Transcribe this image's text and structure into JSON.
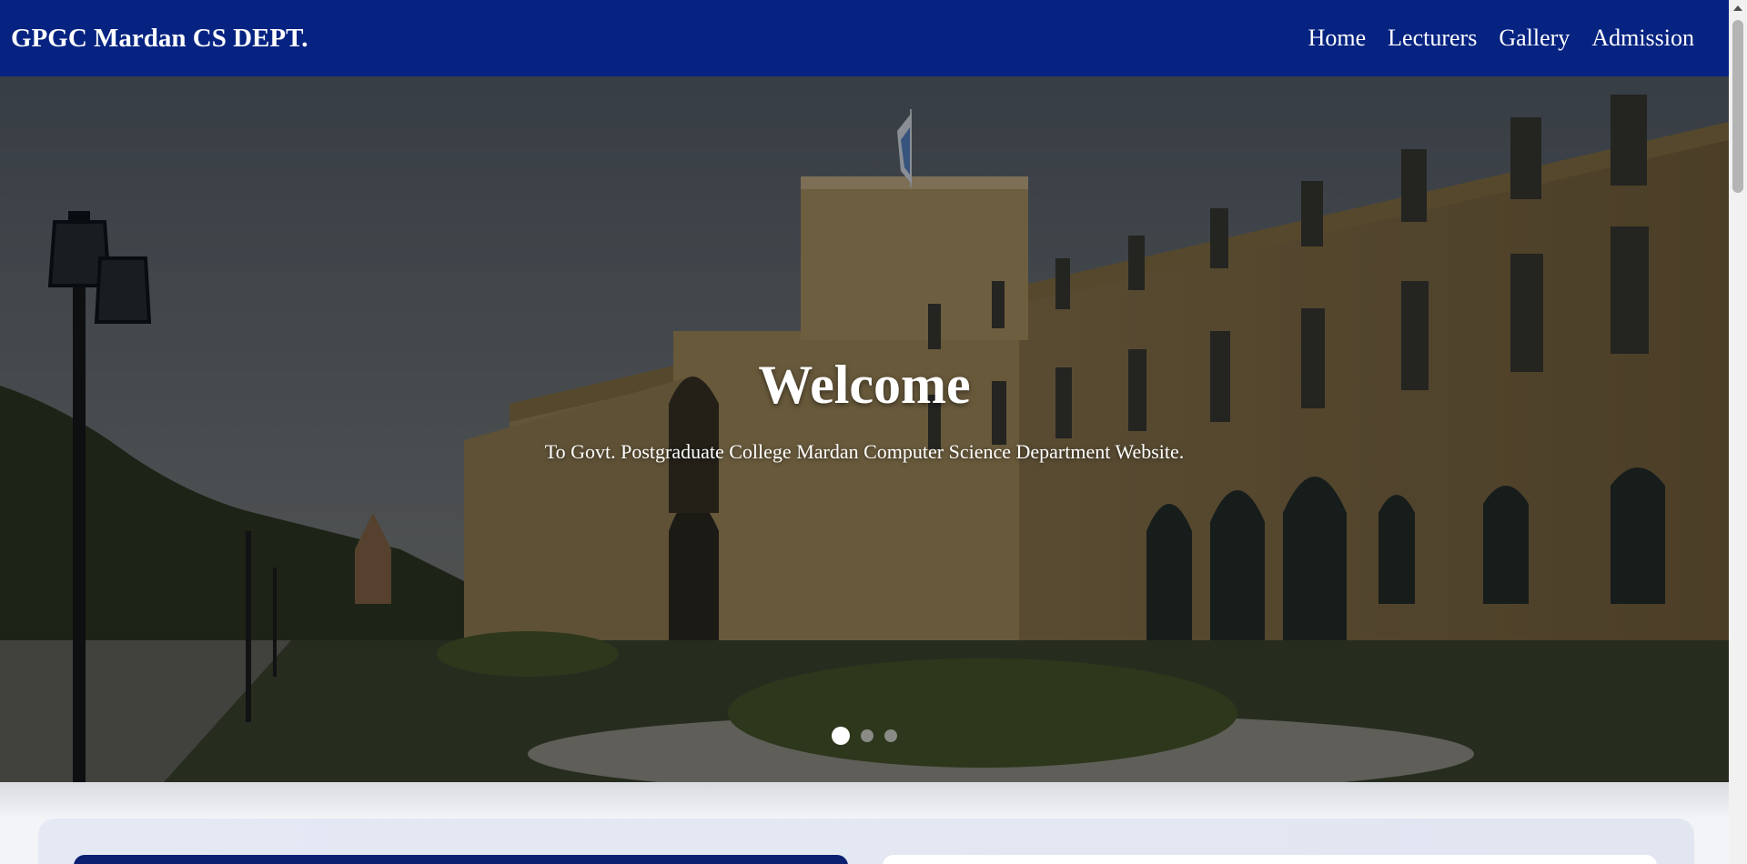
{
  "navbar": {
    "brand": "GPGC Mardan CS DEPT.",
    "links": [
      "Home",
      "Lecturers",
      "Gallery",
      "Admission"
    ],
    "background": "#062381"
  },
  "hero": {
    "title": "Welcome",
    "subtitle": "To Govt. Postgraduate College Mardan Computer Science Department Website.",
    "slides": 3,
    "active_slide": 1
  }
}
